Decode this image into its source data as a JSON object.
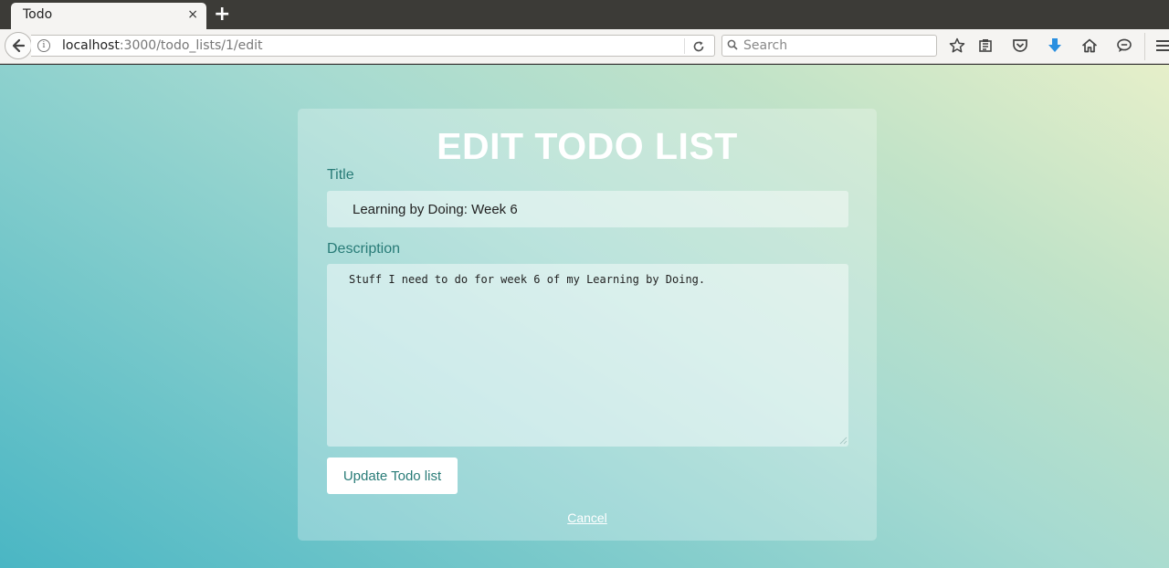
{
  "browser": {
    "tab_title": "Todo",
    "tab_close": "×",
    "new_tab": "+",
    "url_host": "localhost",
    "url_path": ":3000/todo_lists/1/edit",
    "search_placeholder": "Search",
    "icons": [
      "back-arrow-icon",
      "info-icon",
      "reload-icon",
      "search-icon",
      "star-icon",
      "reading-list-icon",
      "pocket-icon",
      "download-icon",
      "home-icon",
      "chat-icon",
      "menu-icon"
    ]
  },
  "form": {
    "heading": "EDIT TODO LIST",
    "title_label": "Title",
    "title_value": "Learning by Doing: Week 6",
    "description_label": "Description",
    "description_value": "Stuff I need to do for week 6 of my Learning by Doing.",
    "submit_label": "Update Todo list",
    "cancel_label": "Cancel"
  },
  "colors": {
    "accent": "#287b77",
    "gradient_start": "#4ab6c4",
    "gradient_end": "#e6efc9",
    "download_icon": "#2a8fe0"
  }
}
